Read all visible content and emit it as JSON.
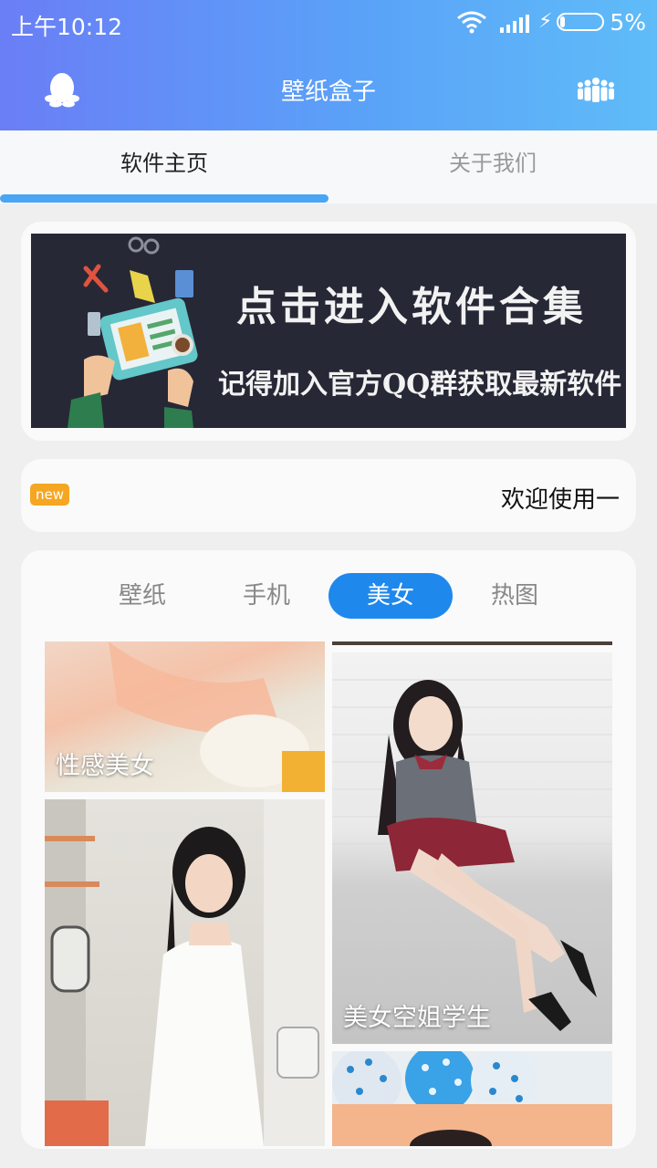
{
  "status_bar": {
    "time": "上午10:12",
    "battery": "5%"
  },
  "app_bar": {
    "title": "壁纸盒子",
    "left_icon": "qq-penguin-icon",
    "right_icon": "group-icon"
  },
  "tabs": [
    {
      "label": "软件主页",
      "active": true
    },
    {
      "label": "关于我们",
      "active": false
    }
  ],
  "banner": {
    "line1": "点击进入软件合集",
    "line2": "记得加入官方QQ群获取最新软件"
  },
  "notice": {
    "badge": "new",
    "text": "欢迎使用一"
  },
  "categories": [
    {
      "label": "壁纸",
      "active": false
    },
    {
      "label": "手机",
      "active": false
    },
    {
      "label": "美女",
      "active": true
    },
    {
      "label": "热图",
      "active": false
    }
  ],
  "gallery": [
    {
      "label": "性感美女"
    },
    {
      "label": ""
    },
    {
      "label": ""
    },
    {
      "label": "美女空姐学生"
    },
    {
      "label": ""
    }
  ],
  "colors": {
    "accent": "#1e88ec",
    "tab_indicator": "#4aa5f3",
    "badge": "#f5a623"
  }
}
